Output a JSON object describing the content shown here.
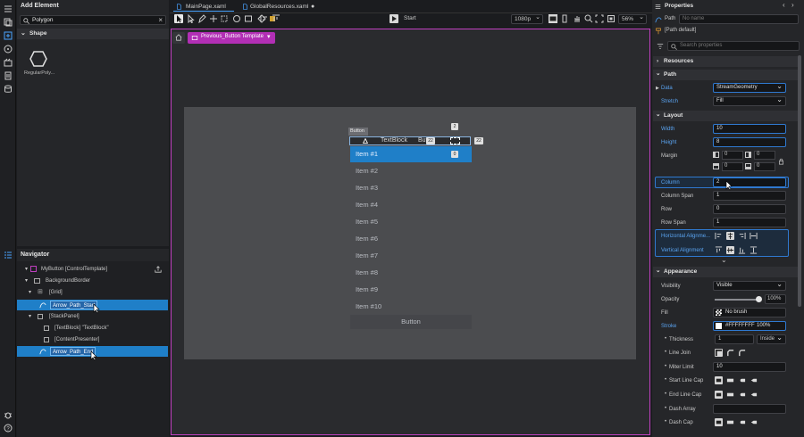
{
  "left_panel": {
    "title": "Add Element",
    "search_value": "Polygon",
    "section": "Shape",
    "item_label": "RegularPoly..."
  },
  "navigator": {
    "title": "Navigator",
    "rows": [
      {
        "label": "MyButton [ControlTemplate]"
      },
      {
        "label": "BackgroundBorder"
      },
      {
        "label": "[Grid]"
      },
      {
        "label": "Arrow_Path_Start"
      },
      {
        "label": "[StackPanel]"
      },
      {
        "label": "[TextBlock] \"TextBlock\""
      },
      {
        "label": "[ContentPresenter]"
      },
      {
        "label": "Arrow_Path_End"
      }
    ]
  },
  "tabs": [
    {
      "label": "MainPage.xaml"
    },
    {
      "label": "GlobalResources.xaml"
    }
  ],
  "toolbar": {
    "start_label": "Start",
    "resolution": "1080p",
    "zoom": "56%"
  },
  "breadcrumb": {
    "label": "Previous_Button Template"
  },
  "design": {
    "button_tag": "Button",
    "textblock_label": "TextBlock",
    "button_partial": "Butt",
    "badge_top": "2",
    "badge_a": "22",
    "badge_b": "22",
    "badge_item": "0",
    "items": [
      "Item #1",
      "Item #2",
      "Item #3",
      "Item #4",
      "Item #5",
      "Item #6",
      "Item #7",
      "Item #8",
      "Item #9",
      "Item #10"
    ],
    "bottom_button": "Button"
  },
  "properties": {
    "title": "Properties",
    "type_label": "Path",
    "name_placeholder": "No name",
    "style_label": "[Path default]",
    "search_placeholder": "Search properties",
    "sections": {
      "resources": "Resources",
      "path": "Path",
      "layout": "Layout",
      "appearance": "Appearance"
    },
    "data_label": "Data",
    "data_value": "StreamGeometry",
    "stretch_label": "Stretch",
    "stretch_value": "Fill",
    "width_label": "Width",
    "width_value": "10",
    "height_label": "Height",
    "height_value": "8",
    "margin_label": "Margin",
    "margin_values": [
      "0",
      "0",
      "0",
      "0"
    ],
    "column_label": "Column",
    "column_value": "2",
    "colspan_label": "Column Span",
    "colspan_value": "1",
    "row_label": "Row",
    "row_value": "0",
    "rowspan_label": "Row Span",
    "rowspan_value": "1",
    "halign_label": "Horizontal Alignme...",
    "valign_label": "Vertical Alignment",
    "visibility_label": "Visibility",
    "visibility_value": "Visible",
    "opacity_label": "Opacity",
    "opacity_value": "100%",
    "fill_label": "Fill",
    "fill_value": "No brush",
    "stroke_label": "Stroke",
    "stroke_value": "#FFFFFFFF",
    "stroke_opacity": "100%",
    "thickness_label": "Thickness",
    "thickness_value": "1",
    "thickness_mode": "Inside",
    "linejoin_label": "Line Join",
    "miter_label": "Miter Limit",
    "miter_value": "10",
    "startcap_label": "Start Line Cap",
    "endcap_label": "End Line Cap",
    "dasharray_label": "Dash Array",
    "dashcap_label": "Dash Cap"
  },
  "colors": {
    "accent": "#1f7fc8",
    "canvas_border": "#c040c0",
    "selection": "#1f7fc8"
  }
}
